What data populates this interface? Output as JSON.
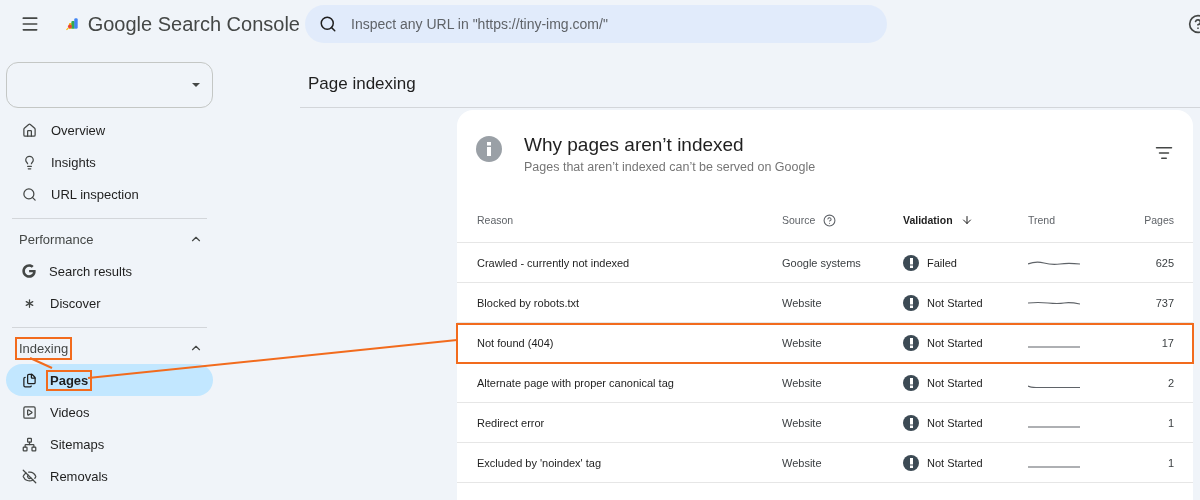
{
  "header": {
    "title": "Google Search Console",
    "search": {
      "placeholder": "Inspect any URL in \"https://tiny-img.com/\""
    }
  },
  "sidebar": {
    "top_items": [
      {
        "label": "Overview",
        "selected": false
      },
      {
        "label": "Insights",
        "selected": false
      },
      {
        "label": "URL inspection",
        "selected": false
      }
    ],
    "sections": [
      {
        "title": "Performance",
        "expanded": true,
        "highlighted": false,
        "items": [
          {
            "label": "Search results",
            "selected": false,
            "highlighted": false
          },
          {
            "label": "Discover",
            "selected": false,
            "highlighted": false
          }
        ]
      },
      {
        "title": "Indexing",
        "expanded": true,
        "highlighted": true,
        "items": [
          {
            "label": "Pages",
            "selected": true,
            "highlighted": true
          },
          {
            "label": "Videos",
            "selected": false,
            "highlighted": false
          },
          {
            "label": "Sitemaps",
            "selected": false,
            "highlighted": false
          },
          {
            "label": "Removals",
            "selected": false,
            "highlighted": false
          }
        ]
      }
    ]
  },
  "page_title": "Page indexing",
  "card": {
    "title": "Why pages aren’t indexed",
    "subtitle": "Pages that aren’t indexed can’t be served on Google",
    "table": {
      "columns": [
        {
          "label": "Reason",
          "kind": "plain"
        },
        {
          "label": "Source",
          "kind": "help"
        },
        {
          "label": "Validation",
          "kind": "sorted"
        },
        {
          "label": "Trend",
          "kind": "plain"
        },
        {
          "label": "Pages",
          "kind": "plain"
        }
      ],
      "rows": [
        {
          "reason": "Crawled - currently not indexed",
          "source": "Google systems",
          "validation": {
            "label": "Failed",
            "kind": "error"
          },
          "pages": "625",
          "highlighted": false
        },
        {
          "reason": "Blocked by robots.txt",
          "source": "Website",
          "validation": {
            "label": "Not Started",
            "kind": "error"
          },
          "pages": "737",
          "highlighted": false
        },
        {
          "reason": "Not found (404)",
          "source": "Website",
          "validation": {
            "label": "Not Started",
            "kind": "error"
          },
          "pages": "17",
          "highlighted": true
        },
        {
          "reason": "Alternate page with proper canonical tag",
          "source": "Website",
          "validation": {
            "label": "Not Started",
            "kind": "error"
          },
          "pages": "2",
          "highlighted": false
        },
        {
          "reason": "Redirect error",
          "source": "Website",
          "validation": {
            "label": "Not Started",
            "kind": "error"
          },
          "pages": "1",
          "highlighted": false
        },
        {
          "reason": "Excluded by 'noindex' tag",
          "source": "Website",
          "validation": {
            "label": "Not Started",
            "kind": "error"
          },
          "pages": "1",
          "highlighted": false
        }
      ]
    }
  }
}
